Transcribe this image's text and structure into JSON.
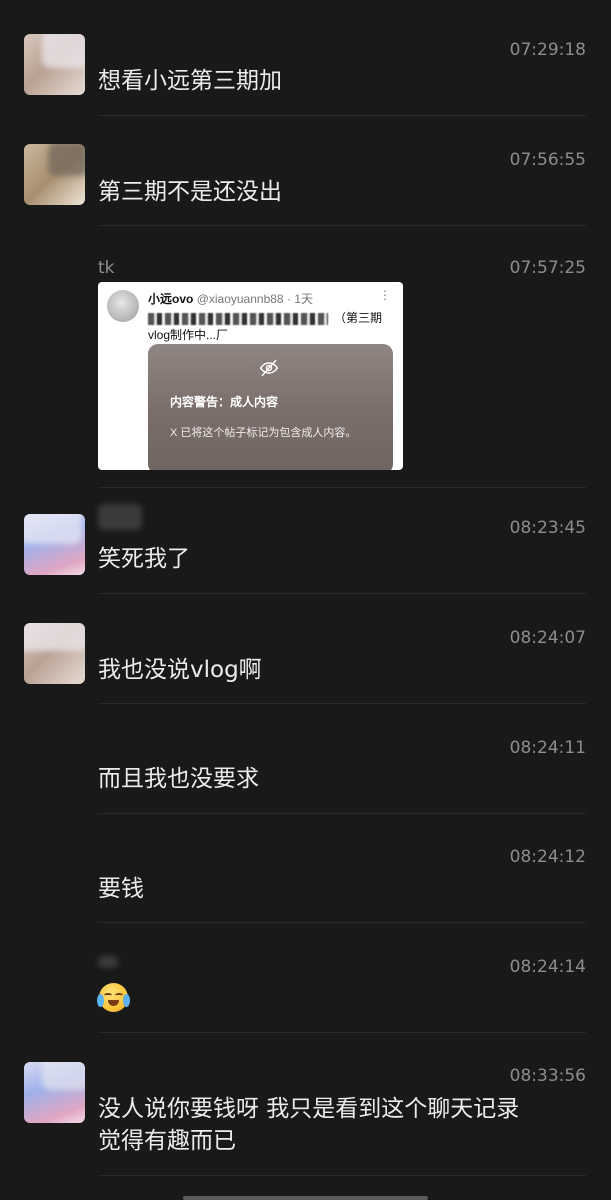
{
  "messages": [
    {
      "sender": "",
      "time": "07:29:18",
      "text": "想看小远第三期加"
    },
    {
      "sender": "",
      "time": "07:56:55",
      "text": "第三期不是还没出"
    },
    {
      "sender": "tk",
      "time": "07:57:25",
      "card": {
        "author": "小远ovo",
        "handle": "@xiaoyuannb88",
        "age": "· 1天",
        "more": "⋮",
        "line1_tail": "（第三期",
        "line2": "vlog制作中...厂",
        "warning_title": "内容警告：成人内容",
        "warning_desc": "X 已将这个帖子标记为包含成人内容。",
        "hide_icon": "eye-off-icon"
      }
    },
    {
      "sender": "",
      "time": "08:23:45",
      "text": "笑死我了"
    },
    {
      "sender": "",
      "time": "08:24:07",
      "text": "我也没说vlog啊"
    },
    {
      "sender": "",
      "time": "08:24:11",
      "text": "而且我也没要求"
    },
    {
      "sender": "",
      "time": "08:24:12",
      "text": "要钱"
    },
    {
      "sender": "",
      "time": "08:24:14",
      "emoji": "loudly-crying-face"
    },
    {
      "sender": "",
      "time": "08:33:56",
      "text_line1": "没人说你要钱呀 我只是看到这个聊天记录",
      "text_line2": "觉得有趣而已"
    }
  ],
  "colors": {
    "background": "#191919",
    "text": "#ececec",
    "meta": "#8d8d8d"
  }
}
